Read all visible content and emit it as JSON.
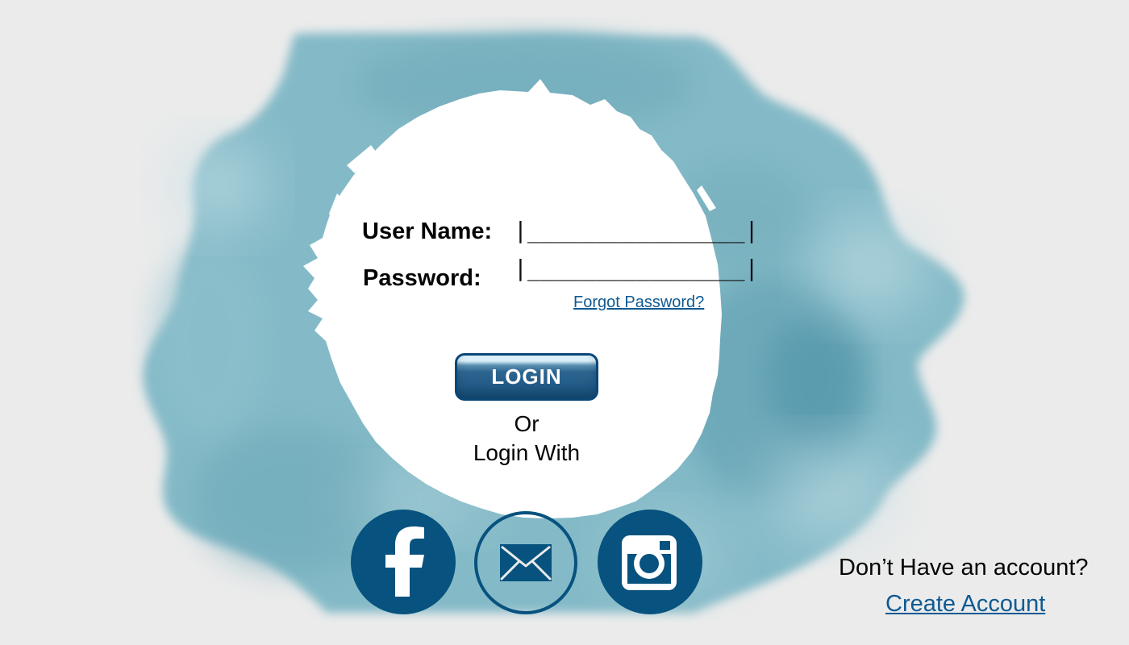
{
  "login_form": {
    "username_label": "User Name:",
    "username_value": "|________________|",
    "password_label": "Password:",
    "password_value": "|________________|",
    "forgot_password": "Forgot Password?",
    "login_button": "LOGIN",
    "or_text": "Or",
    "login_with_text": "Login With"
  },
  "social_login": [
    {
      "icon": "facebook-icon"
    },
    {
      "icon": "email-icon"
    },
    {
      "icon": "instagram-icon"
    }
  ],
  "account_prompt": {
    "question": "Don’t Have an account?",
    "create_account": "Create Account"
  },
  "colors": {
    "page_background": "#ebebeb",
    "watercolor_teal": "#7fb7c4",
    "brand_blue": "#07527e",
    "link_blue": "#0f5a92"
  }
}
